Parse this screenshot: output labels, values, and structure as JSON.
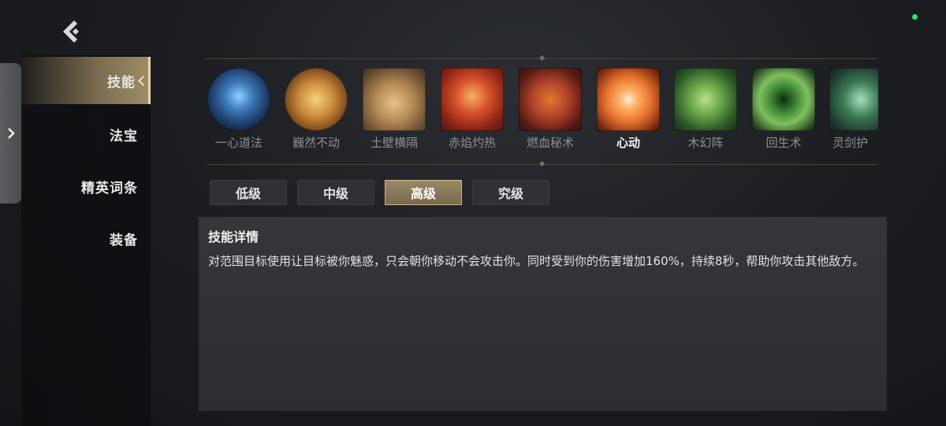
{
  "nav": {
    "items": [
      {
        "label": "技能",
        "active": true
      },
      {
        "label": "法宝",
        "active": false
      },
      {
        "label": "精英词条",
        "active": false
      },
      {
        "label": "装备",
        "active": false
      }
    ]
  },
  "skills": [
    {
      "name": "一心道法",
      "icon": "blue-shield-emblem-icon",
      "color": "#3a6fb0"
    },
    {
      "name": "巍然不动",
      "icon": "golden-seal-icon",
      "color": "#c8893a"
    },
    {
      "name": "土壁横隔",
      "icon": "earth-wall-icon",
      "color": "#b58a55"
    },
    {
      "name": "赤焰灼热",
      "icon": "fire-dragon-icon",
      "color": "#c8402a"
    },
    {
      "name": "燃血秘术",
      "icon": "blood-demon-icon",
      "color": "#b0442a"
    },
    {
      "name": "心动",
      "icon": "flaming-heart-icon",
      "color": "#e8742e"
    },
    {
      "name": "木幻阵",
      "icon": "wood-beast-icon",
      "color": "#4f8a3e"
    },
    {
      "name": "回生术",
      "icon": "green-vortex-icon",
      "color": "#3f8a35"
    },
    {
      "name": "灵剑护",
      "icon": "spirit-sword-icon",
      "color": "#3a7a55"
    }
  ],
  "selected_skill": "心动",
  "levels": [
    {
      "label": "低级",
      "active": false
    },
    {
      "label": "中级",
      "active": false
    },
    {
      "label": "高级",
      "active": true
    },
    {
      "label": "究级",
      "active": false
    }
  ],
  "detail": {
    "title": "技能详情",
    "text": "对范围目标使用让目标被你魅惑，只会朝你移动不会攻击你。同时受到你的伤害增加160%，持续8秒，帮助你攻击其他敌方。"
  },
  "colors": {
    "accent": "#9a8a65",
    "status": "#2ee36a"
  }
}
